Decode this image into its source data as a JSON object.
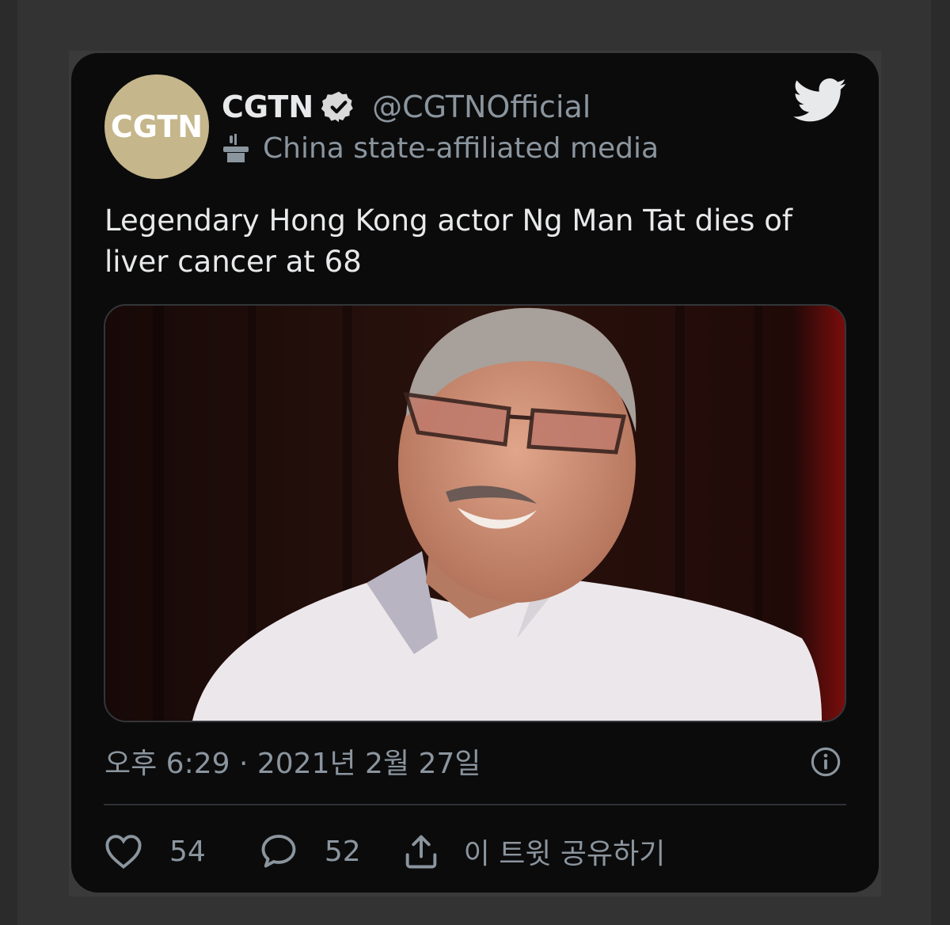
{
  "tweet": {
    "avatar_text": "CGTN",
    "display_name": "CGTN",
    "handle": "@CGTNOfficial",
    "label": "China state-affiliated media",
    "text": "Legendary Hong Kong actor Ng Man Tat dies of liver cancer at 68",
    "timestamp": "오후 6:29 · 2021년 2월 27일",
    "likes": "54",
    "replies": "52",
    "share_label": "이 트윗 공유하기"
  },
  "icons": {
    "verified": "verified-badge-icon",
    "label": "state-media-podium-icon",
    "brand": "twitter-bird-icon",
    "info": "info-icon",
    "like": "heart-icon",
    "reply": "reply-bubble-icon",
    "share": "share-icon"
  },
  "colors": {
    "card_background": "#0b0b0c",
    "page_background": "#2b2b2b",
    "avatar_background": "#c5b68b",
    "primary_text": "#e8e9ea",
    "secondary_text": "#8b959e",
    "divider": "#2f3336"
  }
}
